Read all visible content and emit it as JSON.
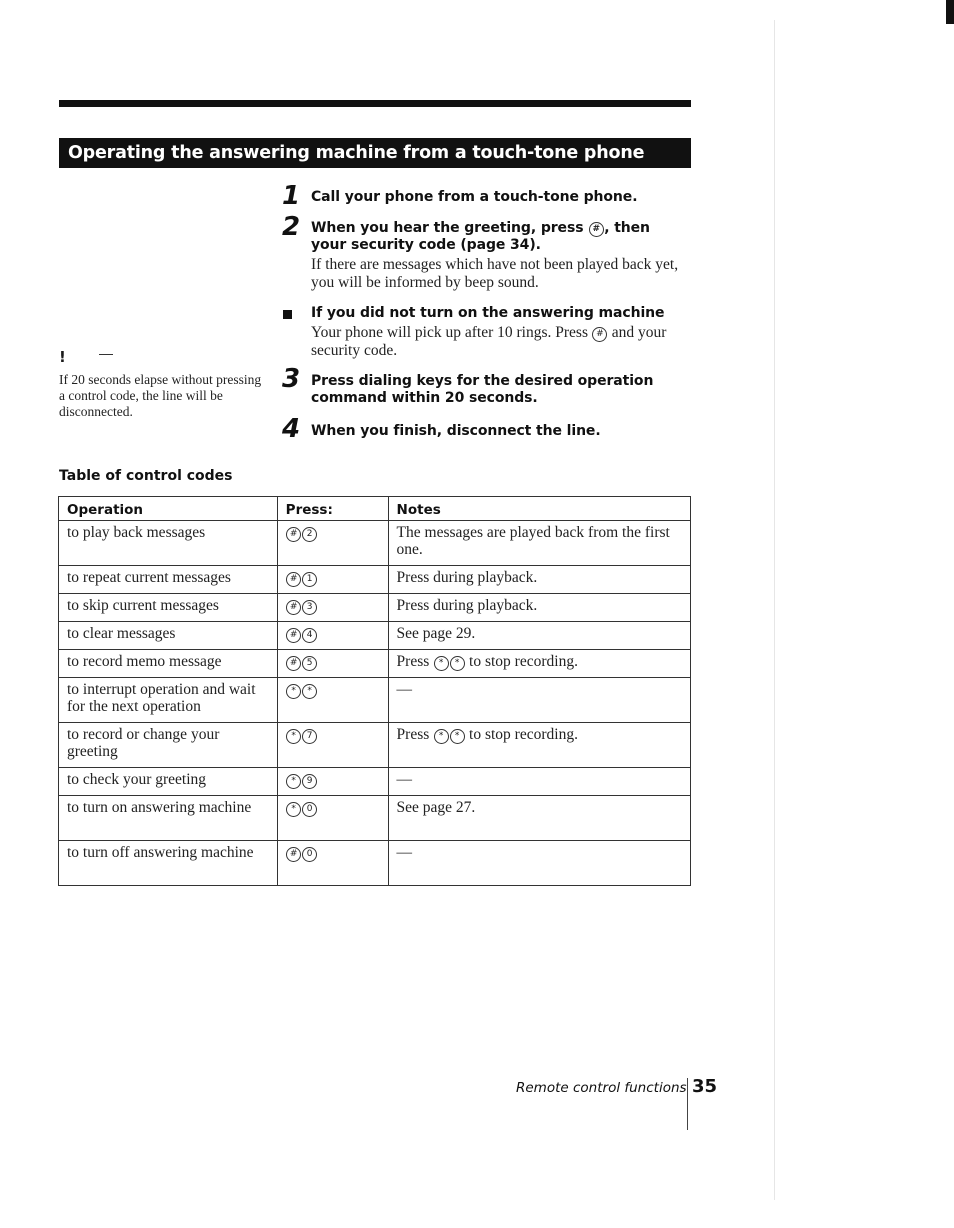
{
  "title": "Operating the answering machine from a touch-tone phone",
  "steps": [
    {
      "number": "1",
      "heading": "Call your phone from a touch-tone phone."
    },
    {
      "number": "2",
      "heading_before_key": "When you hear the greeting, press",
      "heading_key": "#",
      "heading_after_key": ", then",
      "heading_line2": "your security code (page 34).",
      "body": "If there are messages which have not been played back yet, you will be informed by beep sound."
    },
    {
      "number": "3",
      "heading_line1": "Press dialing keys for the desired operation",
      "heading_line2": "command within 20 seconds."
    },
    {
      "number": "4",
      "heading": "When you finish, disconnect the line."
    }
  ],
  "subnote": {
    "heading": "If you did not turn on the answering machine",
    "body_before_key": "Your phone will pick up after 10 rings. Press",
    "key": "#",
    "body_after_key": "and your security code."
  },
  "side_note": {
    "icon": "exclamation-icon",
    "text": "If 20 seconds elapse without pressing a control code, the line will be disconnected."
  },
  "table": {
    "caption": "Table of control codes",
    "headers": [
      "Operation",
      "Press:",
      "Notes"
    ],
    "rows": [
      {
        "operation": "to play back messages",
        "keys": [
          "#",
          "2"
        ],
        "notes": "The messages are played back from the first one."
      },
      {
        "operation": "to repeat current messages",
        "keys": [
          "#",
          "1"
        ],
        "notes": "Press during playback."
      },
      {
        "operation": "to skip current messages",
        "keys": [
          "#",
          "3"
        ],
        "notes": "Press during playback."
      },
      {
        "operation": "to clear messages",
        "keys": [
          "#",
          "4"
        ],
        "notes": "See page 29."
      },
      {
        "operation": "to record memo message",
        "keys": [
          "#",
          "5"
        ],
        "notes_before": "Press",
        "notes_keys": [
          "*",
          "*"
        ],
        "notes_after": "to stop recording."
      },
      {
        "operation": "to interrupt operation and wait for the next operation",
        "keys": [
          "*",
          "*"
        ],
        "notes": "—"
      },
      {
        "operation": "to record or change your greeting",
        "keys": [
          "*",
          "7"
        ],
        "notes_before": "Press",
        "notes_keys": [
          "*",
          "*"
        ],
        "notes_after": "to stop recording."
      },
      {
        "operation": "to check your greeting",
        "keys": [
          "*",
          "9"
        ],
        "notes": "—"
      },
      {
        "operation": "to turn on answering machine",
        "keys": [
          "*",
          "0"
        ],
        "notes": "See page 27."
      },
      {
        "operation": "to turn off answering machine",
        "keys": [
          "#",
          "0"
        ],
        "notes": "—"
      }
    ]
  },
  "footer": {
    "section": "Remote control functions",
    "page": "35"
  }
}
